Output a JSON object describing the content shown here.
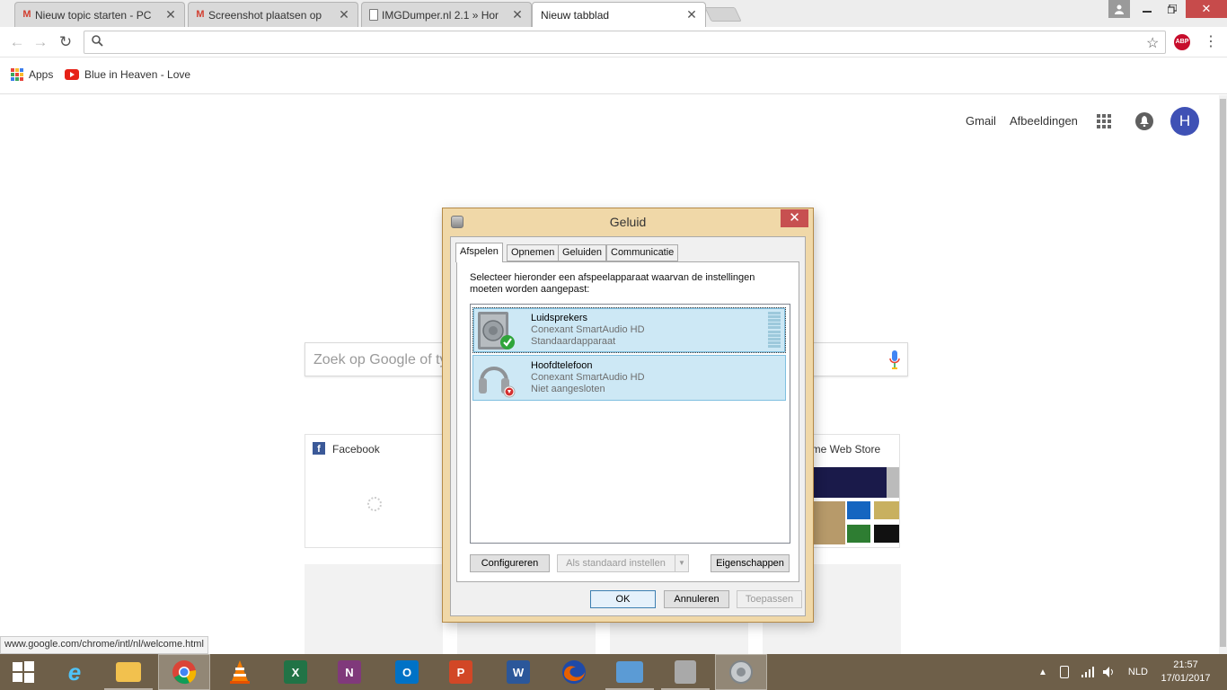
{
  "tabs": [
    {
      "title": "Nieuw topic starten - PC",
      "icon": "gmail-icon"
    },
    {
      "title": "Screenshot plaatsen op",
      "icon": "gmail-icon"
    },
    {
      "title": "IMGDumper.nl 2.1 » Hor",
      "icon": "page-icon"
    },
    {
      "title": "Nieuw tabblad",
      "icon": "none"
    }
  ],
  "bookmarks": {
    "apps": "Apps",
    "youtube": "Blue in Heaven - Love"
  },
  "google": {
    "gmail": "Gmail",
    "images": "Afbeeldingen",
    "avatar": "H",
    "search_placeholder": "Zoek op Google of ty",
    "tile_facebook": "Facebook",
    "tile_store": "ome Web Store"
  },
  "status_url": "www.google.com/chrome/intl/nl/welcome.html",
  "dialog": {
    "title": "Geluid",
    "tabs": [
      "Afspelen",
      "Opnemen",
      "Geluiden",
      "Communicatie"
    ],
    "instruction": "Selecteer hieronder een afspeelapparaat waarvan de instellingen moeten worden aangepast:",
    "devices": [
      {
        "name": "Luidsprekers",
        "driver": "Conexant SmartAudio HD",
        "status": "Standaardapparaat"
      },
      {
        "name": "Hoofdtelefoon",
        "driver": "Conexant SmartAudio HD",
        "status": "Niet aangesloten"
      }
    ],
    "btn_configure": "Configureren",
    "btn_default": "Als standaard instellen",
    "btn_properties": "Eigenschappen",
    "btn_ok": "OK",
    "btn_cancel": "Annuleren",
    "btn_apply": "Toepassen"
  },
  "taskbar": {
    "language": "NLD",
    "time": "21:57",
    "date": "17/01/2017"
  },
  "colors": {
    "accent": "#3f51b5",
    "dialog_frame": "#f0d8a8",
    "taskbar": "#6e5f49"
  }
}
